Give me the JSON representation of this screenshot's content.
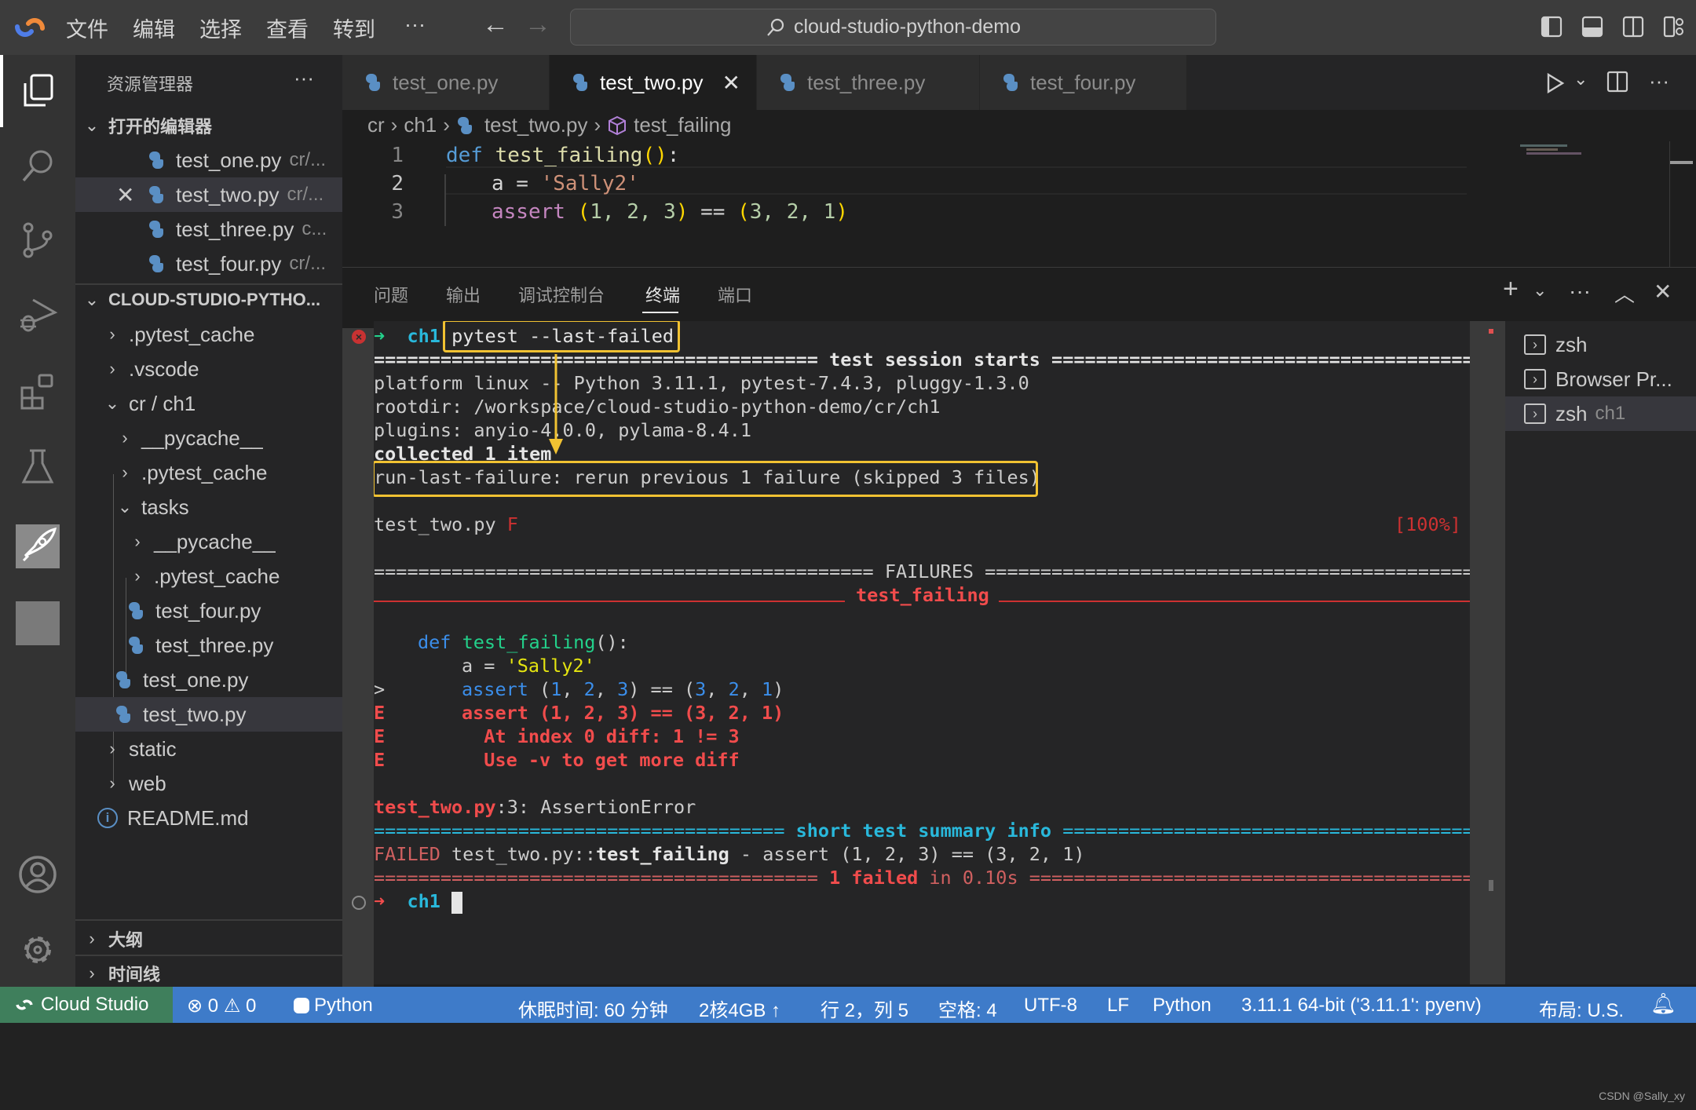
{
  "titlebar": {
    "menu": [
      "文件",
      "编辑",
      "选择",
      "查看",
      "转到",
      "···"
    ],
    "search_text": "cloud-studio-python-demo"
  },
  "activity_bar": {
    "items": [
      "explorer-icon",
      "search-icon",
      "source-control-icon",
      "run-debug-icon",
      "extensions-icon",
      "testing-icon",
      "cloud-deploy-icon",
      "placeholder-icon"
    ],
    "bottom": [
      "account-icon",
      "settings-icon"
    ]
  },
  "sidebar": {
    "title": "资源管理器",
    "more": "···",
    "open_editors": {
      "label": "打开的编辑器",
      "items": [
        {
          "name": "test_one.py",
          "desc": "cr/..."
        },
        {
          "name": "test_two.py",
          "desc": "cr/..."
        },
        {
          "name": "test_three.py",
          "desc": "c..."
        },
        {
          "name": "test_four.py",
          "desc": "cr/..."
        }
      ]
    },
    "workspace": {
      "label": "CLOUD-STUDIO-PYTHO...",
      "tree": [
        {
          "name": ".pytest_cache",
          "type": "folder"
        },
        {
          "name": ".vscode",
          "type": "folder"
        },
        {
          "name": "cr / ch1",
          "type": "folder-open"
        },
        {
          "name": "__pycache__",
          "type": "folder"
        },
        {
          "name": ".pytest_cache",
          "type": "folder"
        },
        {
          "name": "tasks",
          "type": "folder-open"
        },
        {
          "name": "__pycache__",
          "type": "folder"
        },
        {
          "name": ".pytest_cache",
          "type": "folder"
        },
        {
          "name": "test_four.py",
          "type": "python"
        },
        {
          "name": "test_three.py",
          "type": "python"
        },
        {
          "name": "test_one.py",
          "type": "python"
        },
        {
          "name": "test_two.py",
          "type": "python"
        },
        {
          "name": "static",
          "type": "folder"
        },
        {
          "name": "web",
          "type": "folder"
        },
        {
          "name": "README.md",
          "type": "info"
        }
      ]
    },
    "outline_label": "大纲",
    "timeline_label": "时间线"
  },
  "tabs": [
    {
      "label": "test_one.py",
      "active": false
    },
    {
      "label": "test_two.py",
      "active": true
    },
    {
      "label": "test_three.py",
      "active": false
    },
    {
      "label": "test_four.py",
      "active": false
    }
  ],
  "breadcrumb": [
    "cr",
    "ch1",
    "test_two.py",
    "test_failing"
  ],
  "editor": {
    "lines": [
      {
        "num": "1"
      },
      {
        "num": "2"
      },
      {
        "num": "3"
      }
    ],
    "tokens": {
      "def": "def",
      "fname": "test_failing",
      "paren_open": "(",
      "paren_close": ")",
      "colon": ":",
      "a_eq": "a = ",
      "sally": "'Sally2'",
      "assert": "assert",
      "sp": " ",
      "tuple1": "1, 2, 3",
      "eq": " == ",
      "tuple2": "3, 2, 1"
    }
  },
  "panel": {
    "tabs": [
      "问题",
      "输出",
      "调试控制台",
      "终端",
      "端口"
    ],
    "active_tab": "终端",
    "terminal_list": [
      {
        "label": "zsh",
        "desc": ""
      },
      {
        "label": "Browser Pr...",
        "desc": ""
      },
      {
        "label": "zsh",
        "desc": "ch1"
      }
    ]
  },
  "terminal": {
    "prompt_dir": "ch1",
    "prompt_arrow": "➜",
    "command": "pytest --last-failed",
    "session_start": "======================================== test session starts =========================================",
    "platform": "platform linux -- Python 3.11.1, pytest-7.4.3, pluggy-1.3.0",
    "rootdir": "rootdir: /workspace/cloud-studio-python-demo/cr/ch1",
    "plugins": "plugins: anyio-4.0.0, pylama-8.4.1",
    "collected": "collected 1 item",
    "rerun": "run-last-failure: rerun previous 1 failure (skipped 3 files)",
    "test_file": "test_two.py ",
    "test_result": "F",
    "percent": "[100%]",
    "failures_header": "============================================= FAILURES ==============================================",
    "failing_name": "test_failing",
    "src_def": "def",
    "src_fname": "test_failing",
    "src_paren": "():",
    "src_a": "a = ",
    "src_sally": "'Sally2'",
    "marker_gt": ">",
    "src_assert": "assert",
    "marker_e": "E",
    "err1": "assert (1, 2, 3) == (3, 2, 1)",
    "err2": "  At index 0 diff: 1 != 3",
    "err3": "  Use -v to get more diff",
    "location_file": "test_two.py",
    "location_rest": ":3: AssertionError",
    "summary_header_l": "===================================== ",
    "summary_header_t": "short test summary info",
    "summary_header_r": " ==========================================",
    "failed_tag": "FAILED",
    "failed_file": " test_two.py::",
    "failed_test": "test_failing",
    "failed_rest": " - assert (1, 2, 3) == (3, 2, 1)",
    "final_l": "======================================== ",
    "final_failed": "1 failed",
    "final_in": " in 0.10s",
    "final_r": " =========================================="
  },
  "statusbar": {
    "remote": "Cloud Studio",
    "errors": "0",
    "warnings": "0",
    "language_env": "Python",
    "sleep": "休眠时间: 60 分钟",
    "resources": "2核4GB ↑",
    "position": "行 2，列 5",
    "spaces": "空格: 4",
    "encoding": "UTF-8",
    "eol": "LF",
    "language": "Python",
    "interpreter": "3.11.1 64-bit ('3.11.1': pyenv)",
    "layout": "布局: U.S."
  },
  "watermark": "CSDN @Sally_xy",
  "colors": {
    "accent_status": "#3e7bc9",
    "remote_green": "#3f7f5c",
    "highlight_box": "#f1c232",
    "error_red": "#cd3131"
  }
}
